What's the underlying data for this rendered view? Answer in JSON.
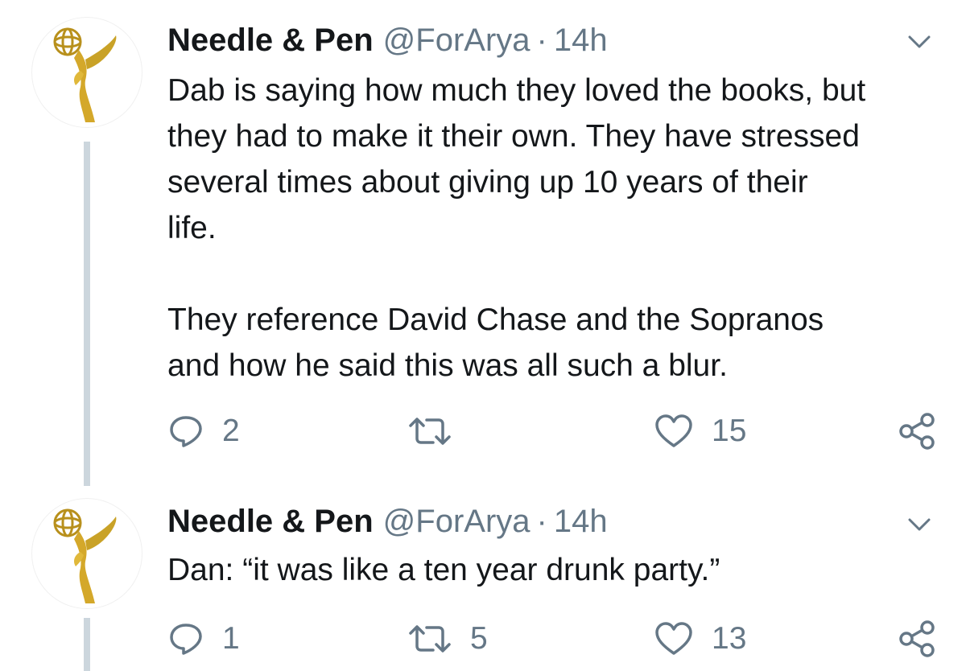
{
  "tweets": [
    {
      "display_name": "Needle & Pen",
      "handle": "@ForArya",
      "separator": "·",
      "time": "14h",
      "text_paragraphs": [
        [
          "Dab is saying how much they loved the books, but",
          "they had to make it their own. They have stressed",
          "several times about giving up 10 years of their",
          "life."
        ],
        [
          "They reference David Chase and the Sopranos",
          "and how he said this was all such a blur."
        ]
      ],
      "reply_count": "2",
      "retweet_count": "",
      "like_count": "15",
      "avatar_icon": "emmy-statuette-icon"
    },
    {
      "display_name": "Needle & Pen",
      "handle": "@ForArya",
      "separator": "·",
      "time": "14h",
      "text_paragraphs": [
        [
          "Dan: “it was like a ten year drunk party.”"
        ]
      ],
      "reply_count": "1",
      "retweet_count": "5",
      "like_count": "13",
      "avatar_icon": "emmy-statuette-icon"
    }
  ],
  "colors": {
    "text": "#14171a",
    "secondary": "#657786",
    "thread_line": "#ccd6dd",
    "gold": "#c9a227"
  },
  "icons": {
    "reply": "reply-icon",
    "retweet": "retweet-icon",
    "like": "heart-icon",
    "share": "share-icon",
    "menu": "chevron-down-icon"
  }
}
